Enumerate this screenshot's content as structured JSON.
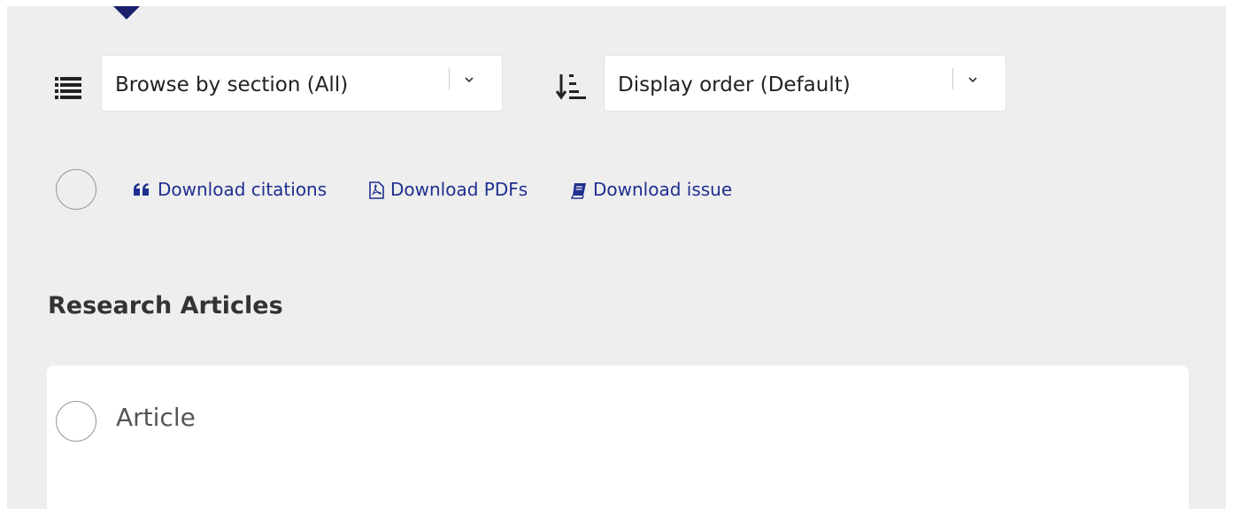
{
  "filters": {
    "section_select": {
      "value": "Browse by section (All)",
      "icon": "list-icon"
    },
    "order_select": {
      "value": "Display order (Default)",
      "icon": "sort-icon"
    }
  },
  "downloads": [
    {
      "label": "Download citations",
      "icon": "quote-icon"
    },
    {
      "label": "Download PDFs",
      "icon": "pdf-icon"
    },
    {
      "label": "Download issue",
      "icon": "book-icon"
    }
  ],
  "section": {
    "heading": "Research Articles",
    "articles": [
      {
        "type_label": "Article"
      }
    ]
  },
  "colors": {
    "accent": "#1a1f6b",
    "link": "#1f2f8f",
    "panel_bg": "#eeeeee"
  }
}
